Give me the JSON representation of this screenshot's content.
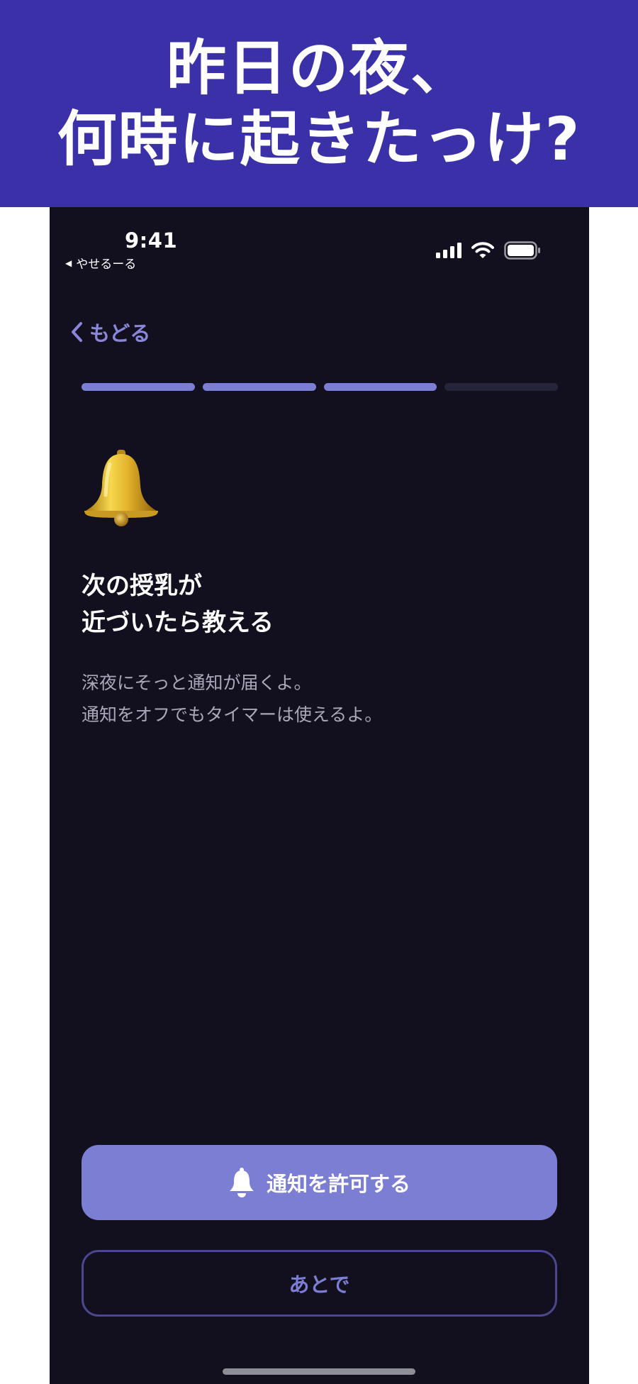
{
  "banner": {
    "line1": "昨日の夜、",
    "line2": "何時に起きたっけ?",
    "background": "#3A30A8"
  },
  "status_bar": {
    "time": "9:41",
    "back_app": "やせるーる",
    "icons": [
      "cellular-signal-icon",
      "wifi-icon",
      "battery-icon"
    ]
  },
  "nav": {
    "back_label": "もどる"
  },
  "progress": {
    "total_steps": 4,
    "completed_steps": 3,
    "active_color": "#7B7ED2",
    "inactive_color": "#26243A"
  },
  "content": {
    "icon": "bell-emoji",
    "title_line1": "次の授乳が",
    "title_line2": "近づいたら教える",
    "desc_line1": "深夜にそっと通知が届くよ。",
    "desc_line2": "通知をオフでもタイマーは使えるよ。"
  },
  "actions": {
    "allow_label": "通知を許可する",
    "later_label": "あとで",
    "accent": "#7B7ED2"
  }
}
